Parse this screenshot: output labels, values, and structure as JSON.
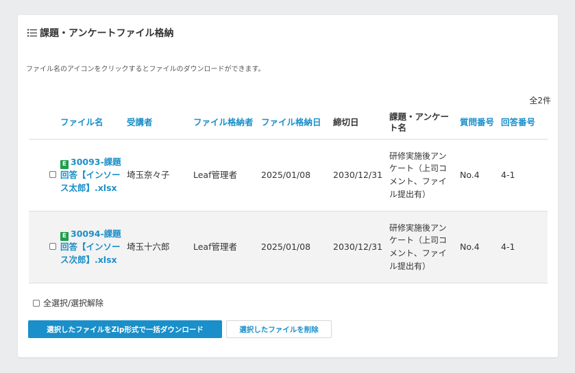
{
  "section": {
    "title": "課題・アンケートファイル格納",
    "description": "ファイル名のアイコンをクリックするとファイルのダウンロードができます。",
    "count": "全2件"
  },
  "table": {
    "headers": {
      "file_name": "ファイル名",
      "trainee": "受講者",
      "stored_by": "ファイル格納者",
      "stored_date": "ファイル格納日",
      "deadline": "締切日",
      "topic": "課題・アンケート名",
      "question_no": "質問番号",
      "answer_no": "回答番号"
    },
    "rows": [
      {
        "file_icon": "E",
        "file_name": "30093-課題回答【インソース太郎】.xlsx",
        "trainee": "埼玉奈々子",
        "stored_by": "Leaf管理者",
        "stored_date": "2025/01/08",
        "deadline": "2030/12/31",
        "topic": "研修実施後アンケート（上司コメント、ファイル提出有）",
        "question_no": "No.4",
        "answer_no": "4-1"
      },
      {
        "file_icon": "E",
        "file_name": "30094-課題回答【インソース次郎】.xlsx",
        "trainee": "埼玉十六郎",
        "stored_by": "Leaf管理者",
        "stored_date": "2025/01/08",
        "deadline": "2030/12/31",
        "topic": "研修実施後アンケート（上司コメント、ファイル提出有）",
        "question_no": "No.4",
        "answer_no": "4-1"
      }
    ]
  },
  "select_all_label": "全選択/選択解除",
  "buttons": {
    "download_zip": "選択したファイルをZip形式で一括ダウンロード",
    "delete": "選択したファイルを削除"
  },
  "colors": {
    "accent": "#1a8fc9",
    "excel_badge": "#1e9e4a"
  },
  "icons": {
    "title": "list-icon",
    "file": "excel-file-icon"
  }
}
